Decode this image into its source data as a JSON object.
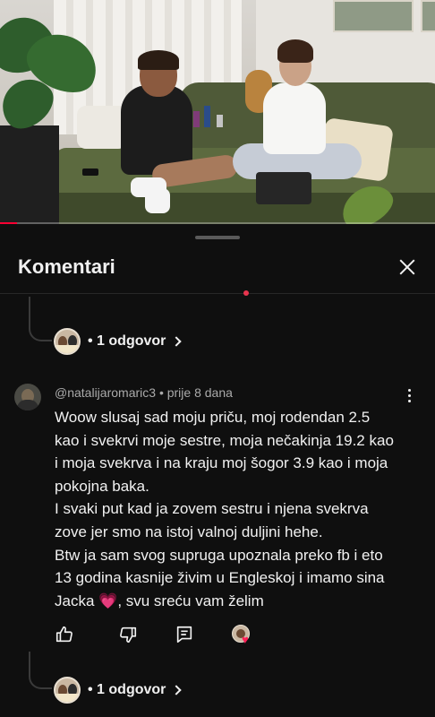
{
  "video": {
    "progress_fraction": 0.04,
    "accent_color": "#ff0033"
  },
  "sheet": {
    "title": "Komentari",
    "close_icon": "close-icon"
  },
  "thread_top": {
    "reply_count_label": "• 1 odgovor"
  },
  "comment": {
    "author": "@natalijaromaric3",
    "age": "• prije 8 dana",
    "lines": [
      "Woow slusaj sad moju priču, moj rodendan 2.5",
      "kao i svekrvi moje sestre, moja nečakinja 19.2 kao",
      "i moja svekrva i na kraju moj šogor 3.9 kao i moja",
      "pokojna baka.",
      "I svaki put kad ja zovem sestru i njena svekrva",
      "zove jer smo na istoj valnoj duljini hehe.",
      "Btw ja sam svog supruga upoznala preko fb i eto",
      "13 godina kasnije živim u Engleskoj i imamo sina"
    ],
    "last_line_start": "Jacka ",
    "last_line_emoji": "💗",
    "last_line_end": ", svu sreću vam želim",
    "actions": {
      "like_icon": "thumbs-up-icon",
      "dislike_icon": "thumbs-down-icon",
      "reply_icon": "reply-comment-icon",
      "creator_heart_icon": "creator-heart-icon",
      "heart_color": "#ff1e56"
    }
  },
  "thread_bottom": {
    "reply_count_label": "• 1 odgovor"
  }
}
